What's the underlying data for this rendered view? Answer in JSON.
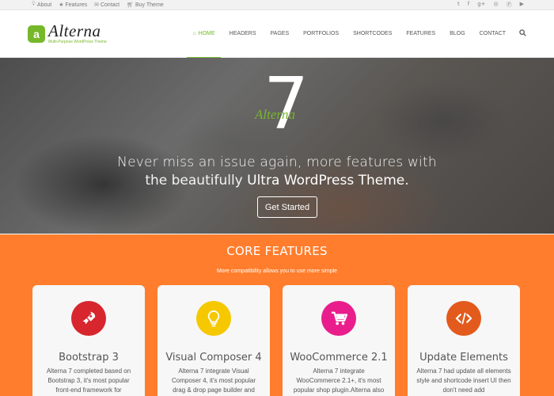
{
  "topbar": {
    "links": [
      {
        "icon": "bulb-icon",
        "label": "About"
      },
      {
        "icon": "star-icon",
        "label": "Features"
      },
      {
        "icon": "mail-icon",
        "label": "Contact"
      },
      {
        "icon": "cart-icon",
        "label": "Buy Theme"
      }
    ],
    "social": [
      "twitter-icon",
      "facebook-icon",
      "google-plus-icon",
      "dribbble-icon",
      "pinterest-icon",
      "youtube-icon"
    ]
  },
  "header": {
    "logo_letter": "a",
    "logo_name": "Alterna",
    "logo_tagline": "Multi-Purpose WordPress Theme",
    "nav": [
      "HOME",
      "HEADERS",
      "PAGES",
      "PORTFOLIOS",
      "SHORTCODES",
      "FEATURES",
      "BLOG",
      "CONTACT"
    ],
    "active_nav": "HOME",
    "accent_color": "#76b82a"
  },
  "hero": {
    "version": "7",
    "brand": "Alterna",
    "line1": "Never miss an issue again, more features with",
    "line2_prefix": "the beautifully ",
    "line2_bold": "Ultra WordPress Theme",
    "line2_suffix": ".",
    "cta_label": "Get Started"
  },
  "features": {
    "title": "CORE FEATURES",
    "subtitle": "More compatibility allows you to use more simple",
    "background": "#ff7d2c",
    "cards": [
      {
        "icon": "rocket-icon",
        "color": "#d8262e",
        "title": "Bootstrap 3",
        "desc": "Alterna 7 completed based on Bootstrap 3, it's most popular front-end framework for"
      },
      {
        "icon": "lightbulb-icon",
        "color": "#f5c800",
        "title": "Visual Composer 4",
        "desc": "Alterna 7 integrate Visual Composer 4, it's most popular drag & drop page builder and"
      },
      {
        "icon": "cart-icon",
        "color": "#e91e8c",
        "title": "WooCommerce 2.1",
        "desc": "Alterna 7 integrate WooCommerce 2.1+, it's most popular shop plugin.Alterna also"
      },
      {
        "icon": "code-icon",
        "color": "#e25a1c",
        "title": "Update Elements",
        "desc": "Alterna 7 had update all elements style and shortcode insert UI then don't need add"
      }
    ]
  }
}
